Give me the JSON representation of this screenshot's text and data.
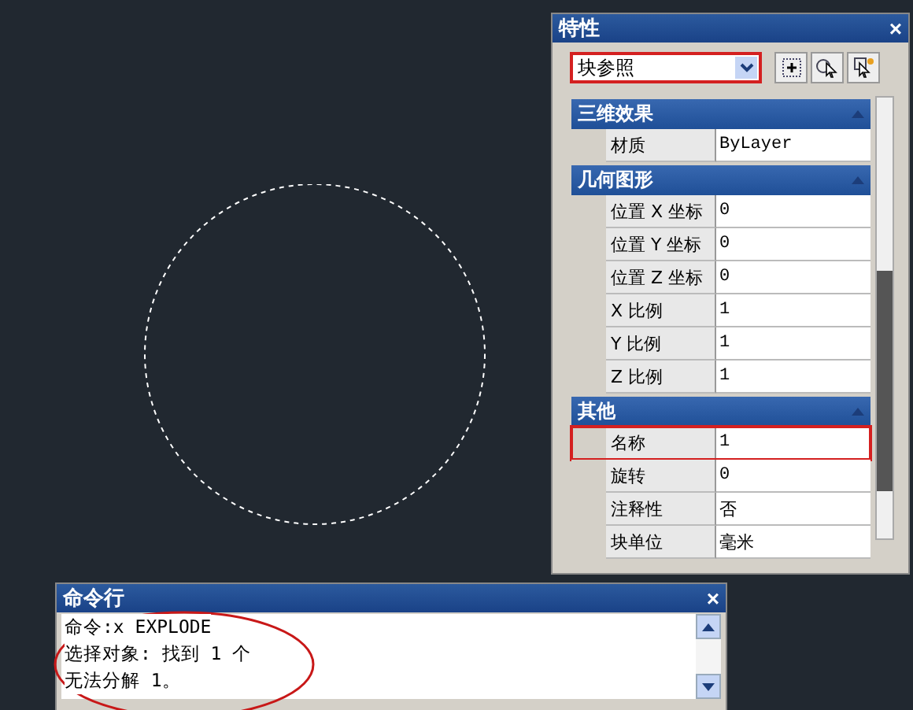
{
  "properties_panel": {
    "title": "特性",
    "close": "×",
    "object_type": {
      "value": "块参照",
      "highlighted": true
    },
    "sections": [
      {
        "title": "三维效果",
        "expanded": true,
        "rows": [
          {
            "label": "材质",
            "value": "ByLayer",
            "highlighted": false
          }
        ]
      },
      {
        "title": "几何图形",
        "expanded": true,
        "rows": [
          {
            "label": "位置 X 坐标",
            "value": "0",
            "highlighted": false
          },
          {
            "label": "位置 Y 坐标",
            "value": "0",
            "highlighted": false
          },
          {
            "label": "位置 Z 坐标",
            "value": "0",
            "highlighted": false
          },
          {
            "label": "X 比例",
            "value": "1",
            "highlighted": false
          },
          {
            "label": "Y 比例",
            "value": "1",
            "highlighted": false
          },
          {
            "label": "Z 比例",
            "value": "1",
            "highlighted": false
          }
        ]
      },
      {
        "title": "其他",
        "expanded": true,
        "rows": [
          {
            "label": "名称",
            "value": "1",
            "highlighted": true
          },
          {
            "label": "旋转",
            "value": "0",
            "highlighted": false
          },
          {
            "label": "注释性",
            "value": "否",
            "highlighted": false
          },
          {
            "label": "块单位",
            "value": "毫米",
            "highlighted": false
          }
        ]
      }
    ]
  },
  "command_line": {
    "title": "命令行",
    "close": "×",
    "highlighted": true,
    "lines": [
      "命令:x EXPLODE",
      "选择对象: 找到 1 个",
      "无法分解 1。"
    ]
  }
}
